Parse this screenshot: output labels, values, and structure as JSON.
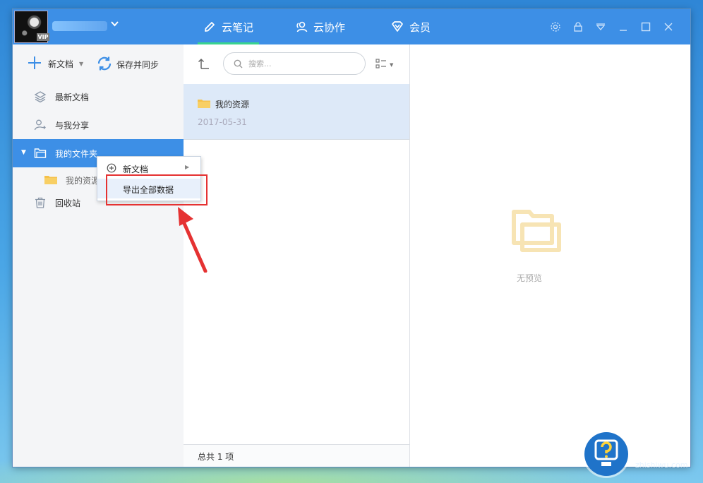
{
  "header": {
    "vip_badge": "VIP",
    "tabs": [
      {
        "label": "云笔记",
        "icon": "pencil-icon",
        "active": true
      },
      {
        "label": "云协作",
        "icon": "people-icon",
        "active": false
      },
      {
        "label": "会员",
        "icon": "diamond-icon",
        "active": false
      }
    ],
    "controls": [
      "gear-icon",
      "lock-icon",
      "menu-icon",
      "minimize-icon",
      "maximize-icon",
      "close-icon"
    ]
  },
  "sidebar": {
    "new_doc_label": "新文档",
    "sync_label": "保存并同步",
    "items": [
      {
        "label": "最新文档",
        "icon": "layers-icon"
      },
      {
        "label": "与我分享",
        "icon": "share-user-icon"
      },
      {
        "label": "我的文件夹",
        "icon": "folder-icon",
        "selected": true
      },
      {
        "label": "我的资源",
        "icon": "yellow-folder-icon"
      },
      {
        "label": "回收站",
        "icon": "trash-icon"
      }
    ]
  },
  "list": {
    "search_placeholder": "搜索...",
    "items": [
      {
        "name": "我的资源",
        "date": "2017-05-31"
      }
    ],
    "footer": "总共 1 项"
  },
  "preview": {
    "empty_text": "无预览"
  },
  "context_menu": {
    "items": [
      {
        "label": "新文档",
        "has_submenu": true
      },
      {
        "label": "导出全部数据",
        "highlighted": true
      }
    ]
  },
  "watermark": {
    "title": "知识屋",
    "url": "zhishiwu.com"
  },
  "colors": {
    "accent": "#3d8fe6",
    "tab_underline": "#39d48f",
    "selection_bg": "#dde9f8",
    "annotation_red": "#e53232",
    "folder_yellow": "#f5c14a"
  }
}
